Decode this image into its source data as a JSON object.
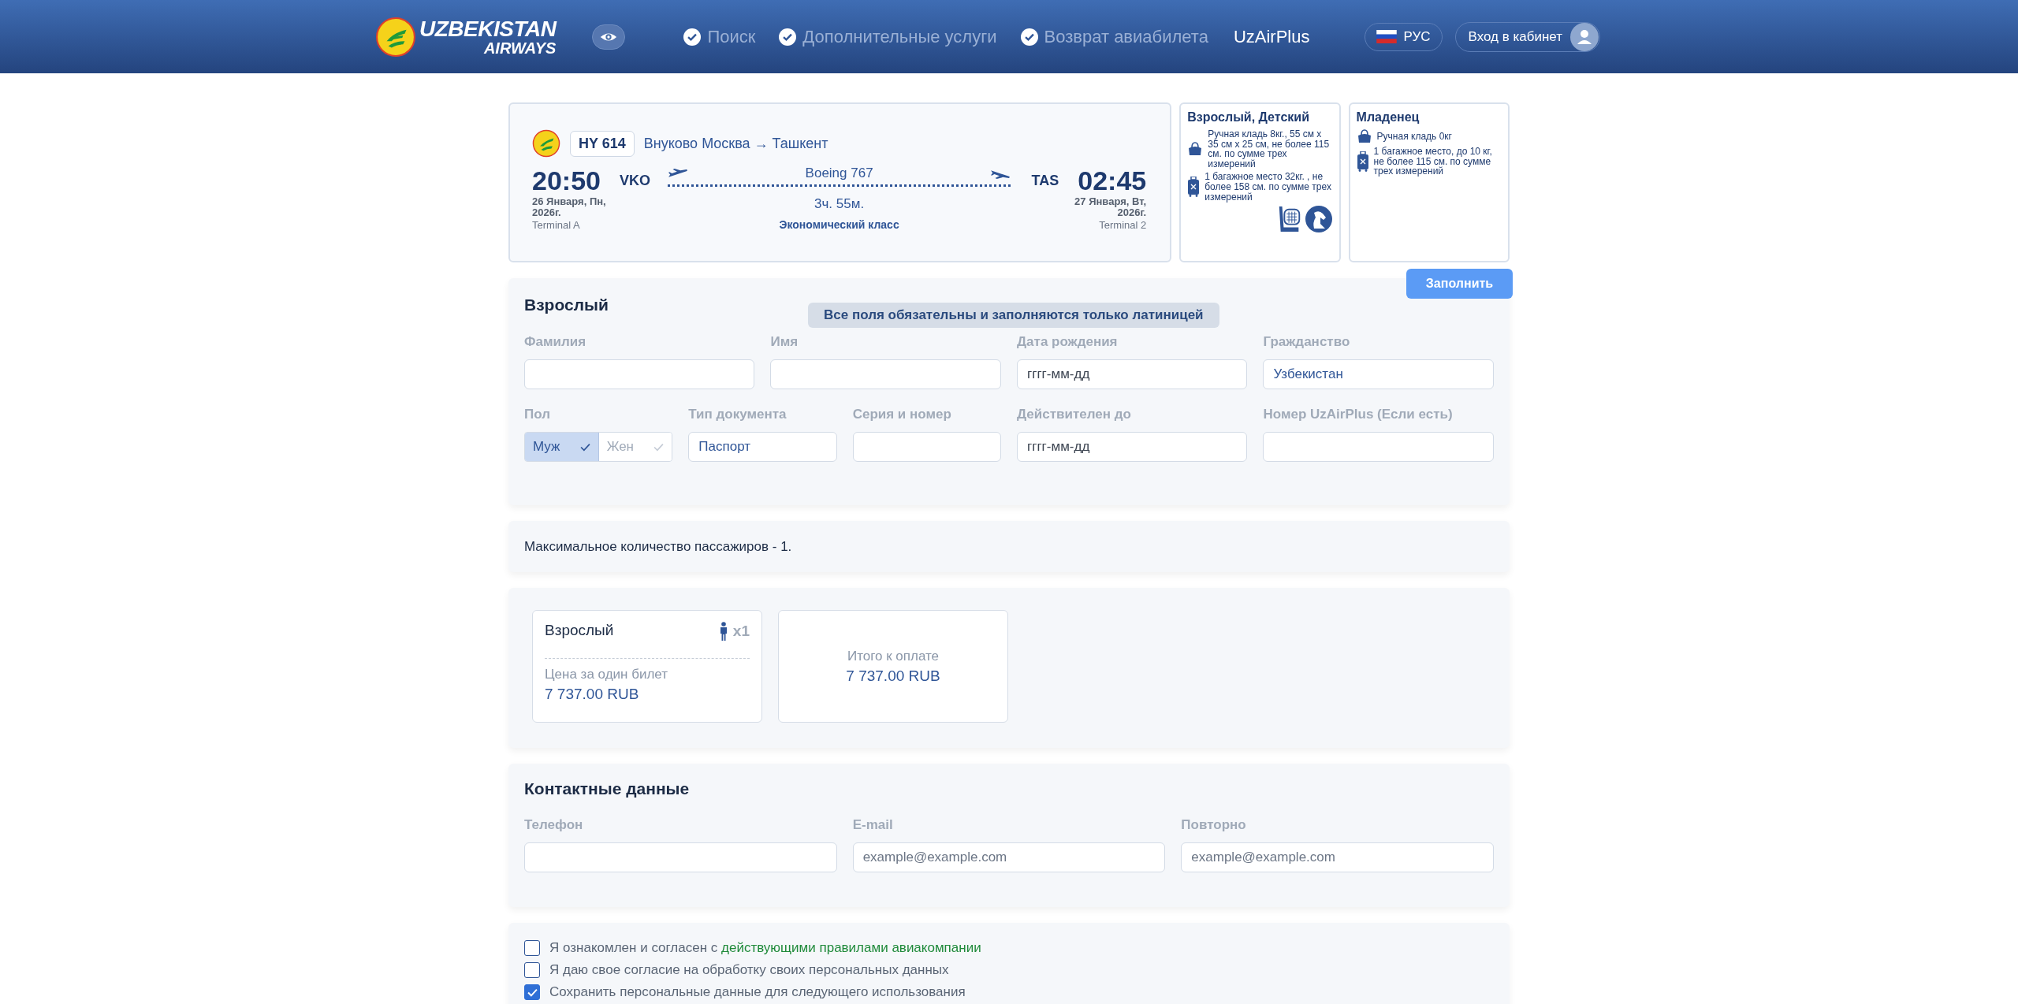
{
  "header": {
    "logo": {
      "line1": "UZBEKISTAN",
      "line2": "AIRWAYS"
    },
    "nav": [
      {
        "label": "Поиск",
        "kind": "step"
      },
      {
        "label": "Дополнительные услуги",
        "kind": "step"
      },
      {
        "label": "Возврат авиабилета",
        "kind": "step"
      },
      {
        "label": "UzAirPlus",
        "kind": "plain"
      }
    ],
    "language": "РУС",
    "login": "Вход в кабинет"
  },
  "flight": {
    "number": "HY 614",
    "route": "Внуково Москва → Ташкент",
    "dep_time": "20:50",
    "dep_code": "VKO",
    "dep_date": "26 Января, Пн, 2026г.",
    "dep_terminal": "Terminal A",
    "aircraft": "Boeing 767",
    "duration": "3ч. 55м.",
    "cabin": "Экономический класс",
    "arr_code": "TAS",
    "arr_time": "02:45",
    "arr_date": "27 Января, Вт, 2026г.",
    "arr_terminal": "Terminal 2"
  },
  "baggage": [
    {
      "title": "Взрослый, Детский",
      "pets": true,
      "items": [
        {
          "kind": "hand",
          "text": "Ручная кладь 8кг., 55 см x 35 см x 25 см, не более 115 см. по сумме трех измерений"
        },
        {
          "kind": "bag",
          "text": "1 багажное место 32кг. , не более 158 см. по сумме трех измерений"
        }
      ]
    },
    {
      "title": "Младенец",
      "pets": false,
      "items": [
        {
          "kind": "hand",
          "text": "Ручная кладь 0кг"
        },
        {
          "kind": "bag",
          "text": "1 багажное место, до 10 кг, не более 115 см. по сумме трех измерений"
        }
      ]
    }
  ],
  "fill_button": "Заполнить",
  "passenger": {
    "title": "Взрослый",
    "notice": "Все поля обязательны и заполняются только латиницей",
    "fields": [
      {
        "kind": "text",
        "label": "Фамилия"
      },
      {
        "kind": "text",
        "label": "Имя"
      },
      {
        "kind": "text",
        "label": "Дата рождения",
        "placeholder": "гггг-мм-дд"
      },
      {
        "kind": "text",
        "label": "Гражданство",
        "value": "Узбекистан"
      },
      {
        "kind": "toggle",
        "label": "Пол",
        "options": [
          {
            "label": "Муж",
            "selected": true
          },
          {
            "label": "Жен",
            "selected": false
          }
        ]
      },
      {
        "kind": "text",
        "label": "Тип документа",
        "value": "Паспорт"
      },
      {
        "kind": "text",
        "label": "Серия и номер"
      },
      {
        "kind": "text",
        "label": "Действителен до",
        "placeholder": "гггг-мм-дд"
      },
      {
        "kind": "text",
        "label": "Номер UzAirPlus (Если есть)"
      }
    ]
  },
  "note": "Максимальное количество пассажиров - 1.",
  "price": {
    "fare": {
      "title": "Взрослый",
      "count": "x1",
      "label": "Цена за один билет",
      "amount": "7 737.00 RUB"
    },
    "total": {
      "label": "Итого к оплате",
      "amount": "7 737.00 RUB"
    }
  },
  "contacts": {
    "title": "Контактные данные",
    "fields": [
      {
        "label": "Телефон"
      },
      {
        "label": "E-mail",
        "placeholder": "example@example.com"
      },
      {
        "label": "Повторно",
        "placeholder": "example@example.com"
      }
    ]
  },
  "agreements": [
    {
      "text": "Я ознакомлен и согласен с ",
      "link": "действующими правилами авиакомпании",
      "checked": false
    },
    {
      "text": "Я даю свое согласие на обработку своих персональных данных",
      "checked": false
    },
    {
      "text": "Сохранить персональные данные для следующего использования",
      "checked": true
    }
  ]
}
